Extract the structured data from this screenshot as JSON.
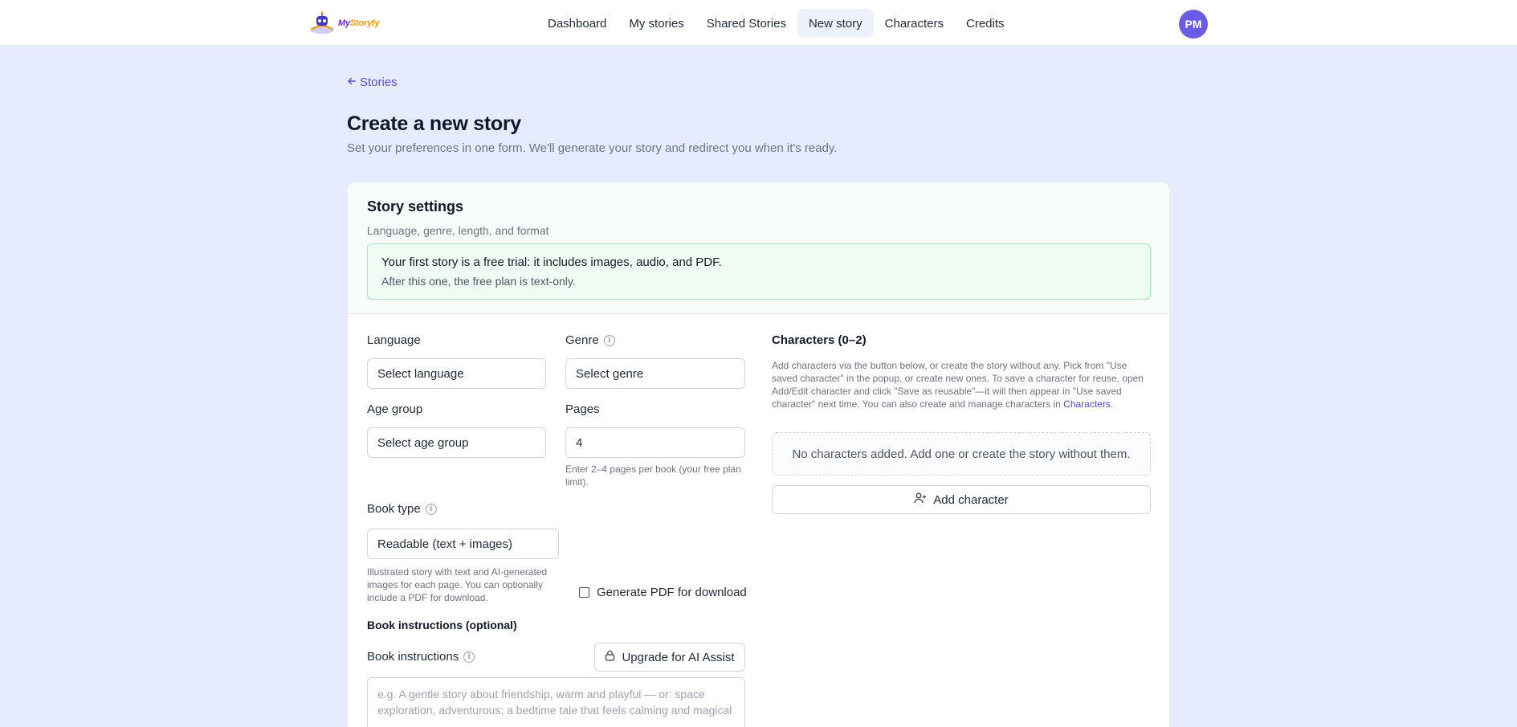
{
  "brand": {
    "name_part1": "My",
    "name_part2": "Storyfy"
  },
  "nav": {
    "items": [
      "Dashboard",
      "My stories",
      "Shared Stories",
      "New story",
      "Characters",
      "Credits"
    ],
    "active": "New story"
  },
  "user": {
    "initials": "PM"
  },
  "back_link": "Stories",
  "page": {
    "title": "Create a new story",
    "subtitle": "Set your preferences in one form. We'll generate your story and redirect you when it's ready."
  },
  "settings": {
    "title": "Story settings",
    "subtitle": "Language, genre, length, and format",
    "notice_line1": "Your first story is a free trial: it includes images, audio, and PDF.",
    "notice_line2": "After this one, the free plan is text-only."
  },
  "form": {
    "language_label": "Language",
    "language_value": "Select language",
    "genre_label": "Genre",
    "genre_value": "Select genre",
    "age_label": "Age group",
    "age_value": "Select age group",
    "pages_label": "Pages",
    "pages_value": "4",
    "pages_help": "Enter 2–4 pages per book (your free plan limit).",
    "book_type_label": "Book type",
    "book_type_value": "Readable (text + images)",
    "book_type_help": "Illustrated story with text and AI-generated images for each page. You can optionally include a PDF for download.",
    "pdf_label": "Generate PDF for download",
    "instructions_section": "Book instructions (optional)",
    "instructions_label": "Book instructions",
    "upgrade_label": "Upgrade for AI Assist",
    "instructions_placeholder": "e.g. A gentle story about friendship, warm and playful — or: space exploration, adventurous; a bedtime tale that feels calming and magical"
  },
  "characters": {
    "title": "Characters (0–2)",
    "desc": "Add characters via the button below, or create the story without any. Pick from \"Use saved character\" in the popup, or create new ones. To save a character for reuse, open Add/Edit character and click \"Save as reusable\"—it will then appear in \"Use saved character\" next time. You can also create and manage characters in",
    "desc_link": "Characters",
    "empty": "No characters added. Add one or create the story without them.",
    "add_label": "Add character"
  },
  "icons": {
    "back": "arrow-left-icon",
    "info": "info-icon",
    "lock": "lock-icon",
    "add_user": "user-plus-icon"
  }
}
